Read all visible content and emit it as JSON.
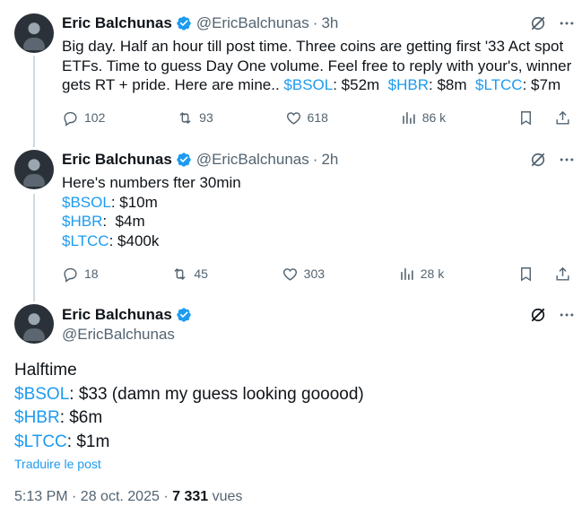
{
  "tweet1": {
    "author_name": "Eric Balchunas",
    "handle": "@EricBalchunas",
    "time": "3h",
    "text_lines": [
      "Big day. Half an hour till post time. Three coins are getting first '33 Act spot",
      "ETFs. Time to guess Day One volume. Feel free to reply with your's, winner",
      "gets RT + pride. Here are mine.. "
    ],
    "guesses": [
      {
        "tag": "$BSOL",
        "value": ": $52m"
      },
      {
        "tag": "$HBR",
        "value": ": $8m"
      },
      {
        "tag": "$LTCC",
        "value": ": $7m"
      }
    ],
    "replies": "102",
    "retweets": "93",
    "likes": "618",
    "views": "86 k"
  },
  "tweet2": {
    "author_name": "Eric Balchunas",
    "handle": "@EricBalchunas",
    "time": "2h",
    "intro": "Here's numbers fter 30min",
    "lines": [
      {
        "tag": "$BSOL",
        "value": ": $10m"
      },
      {
        "tag": "$HBR",
        "value": ":  $4m"
      },
      {
        "tag": "$LTCC",
        "value": ": $400k"
      }
    ],
    "replies": "18",
    "retweets": "45",
    "likes": "303",
    "views": "28 k"
  },
  "main_tweet": {
    "author_name": "Eric Balchunas",
    "handle": "@EricBalchunas",
    "intro": "Halftime",
    "lines": [
      {
        "tag": "$BSOL",
        "value": ": $33 (damn my guess looking gooood)"
      },
      {
        "tag": "$HBR",
        "value": ": $6m"
      },
      {
        "tag": "$LTCC",
        "value": ": $1m"
      }
    ],
    "translate_label": "Traduire le post",
    "timestamp": "5:13 PM · 28 oct. 2025 · ",
    "views_count": "7 331",
    "views_label": " vues"
  },
  "colors": {
    "accent": "#1d9bf0",
    "secondary_text": "#536471",
    "thread_line": "#cfd9de"
  }
}
